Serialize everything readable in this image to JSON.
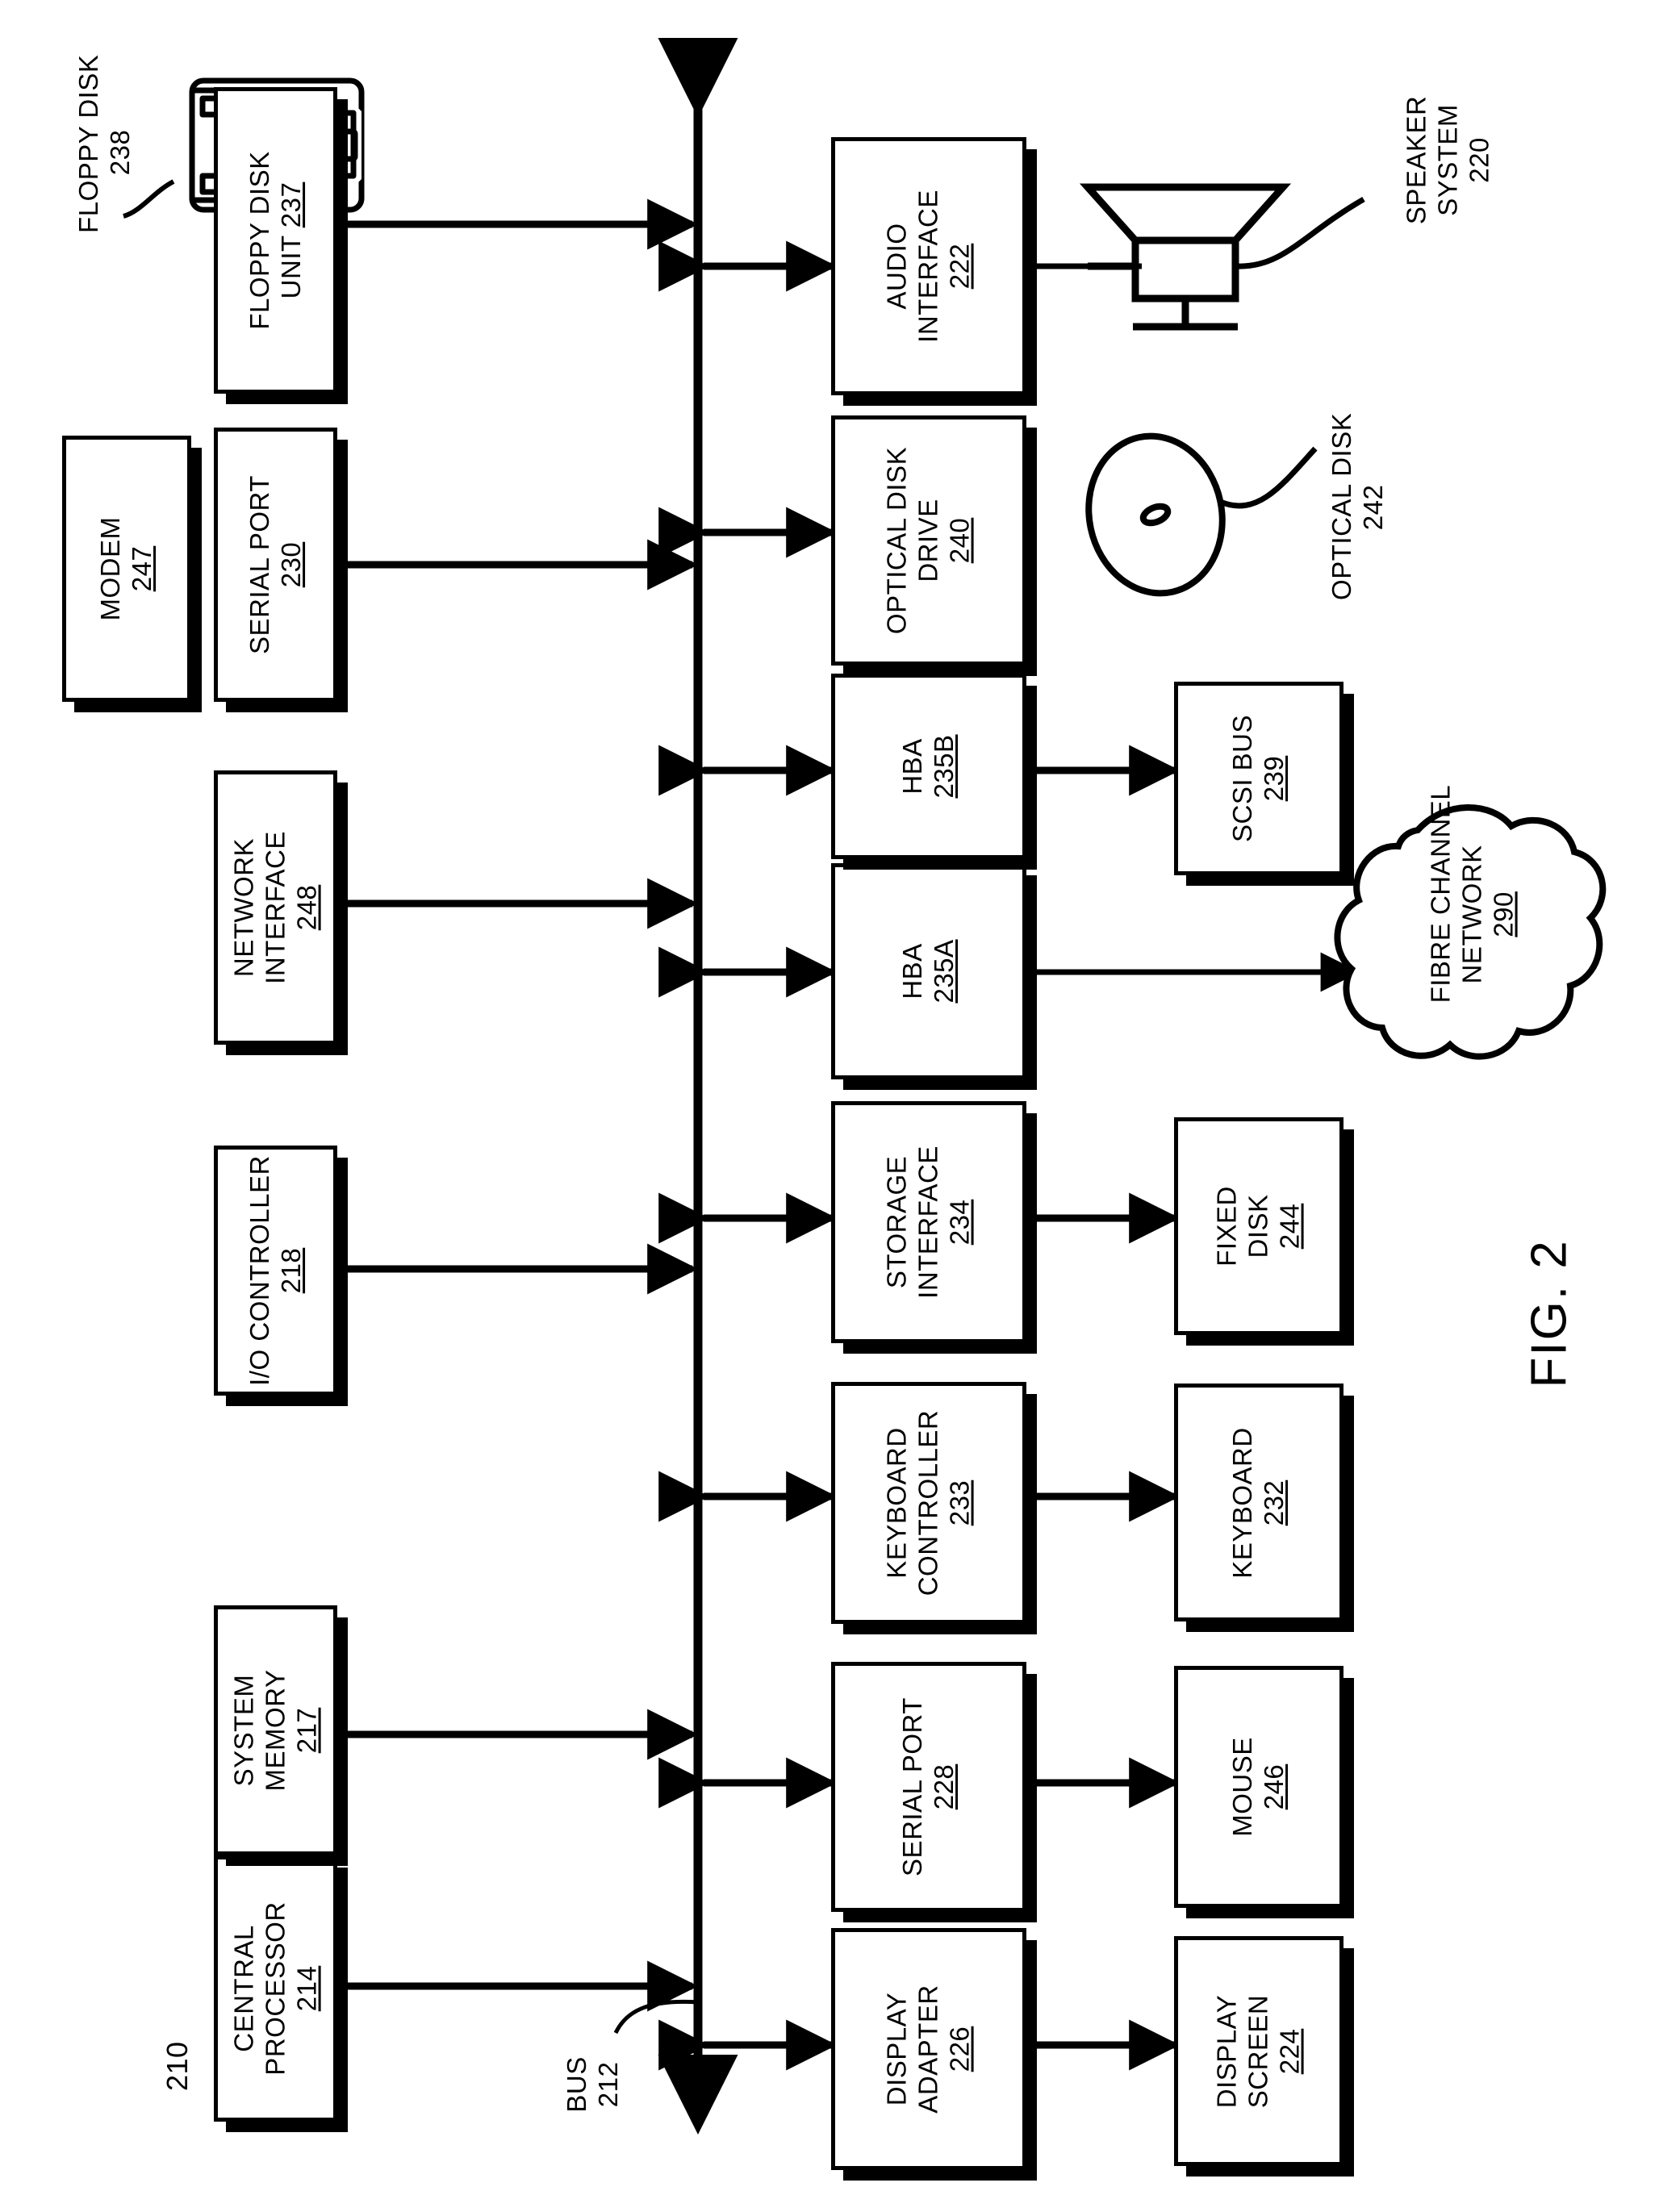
{
  "figure": {
    "caption": "FIG. 2",
    "system_ref": "210",
    "bus": {
      "label": "BUS",
      "ref": "212"
    }
  },
  "boxes": [
    {
      "id": "central-processor",
      "title": "CENTRAL\nPROCESSOR",
      "ref": "214"
    },
    {
      "id": "system-memory",
      "title": "SYSTEM\nMEMORY",
      "ref": "217"
    },
    {
      "id": "io-controller",
      "title": "I/O CONTROLLER",
      "ref": "218"
    },
    {
      "id": "network-interface",
      "title": "NETWORK\nINTERFACE",
      "ref": "248"
    },
    {
      "id": "serial-port-230",
      "title": "SERIAL PORT",
      "ref": "230"
    },
    {
      "id": "floppy-disk-unit",
      "title": "FLOPPY DISK\nUNIT",
      "ref": "237"
    },
    {
      "id": "modem",
      "title": "MODEM",
      "ref": "247"
    },
    {
      "id": "display-adapter",
      "title": "DISPLAY\nADAPTER",
      "ref": "226"
    },
    {
      "id": "serial-port-228",
      "title": "SERIAL PORT",
      "ref": "228"
    },
    {
      "id": "keyboard-controller",
      "title": "KEYBOARD\nCONTROLLER",
      "ref": "233"
    },
    {
      "id": "storage-interface",
      "title": "STORAGE\nINTERFACE",
      "ref": "234"
    },
    {
      "id": "hba-235a",
      "title": "HBA",
      "ref": "235A"
    },
    {
      "id": "hba-235b",
      "title": "HBA",
      "ref": "235B"
    },
    {
      "id": "optical-disk-drive",
      "title": "OPTICAL DISK\nDRIVE",
      "ref": "240"
    },
    {
      "id": "audio-interface",
      "title": "AUDIO\nINTERFACE",
      "ref": "222"
    },
    {
      "id": "display-screen",
      "title": "DISPLAY\nSCREEN",
      "ref": "224"
    },
    {
      "id": "mouse",
      "title": "MOUSE",
      "ref": "246"
    },
    {
      "id": "keyboard",
      "title": "KEYBOARD",
      "ref": "232"
    },
    {
      "id": "fixed-disk",
      "title": "FIXED\nDISK",
      "ref": "244"
    },
    {
      "id": "scsi-bus",
      "title": "SCSI BUS",
      "ref": "239"
    }
  ],
  "labels": [
    {
      "id": "floppy-disk",
      "title": "FLOPPY DISK",
      "ref": "238",
      "underline": false
    },
    {
      "id": "speaker-system",
      "title": "SPEAKER\nSYSTEM",
      "ref": "220",
      "underline": false
    },
    {
      "id": "optical-disk",
      "title": "OPTICAL DISK",
      "ref": "242",
      "underline": false
    }
  ],
  "cloud": {
    "id": "fibre-channel-network",
    "title": "FIBRE CHANNEL\nNETWORK",
    "ref": "290"
  },
  "colors": {
    "ink": "#000000",
    "paper": "#ffffff"
  }
}
